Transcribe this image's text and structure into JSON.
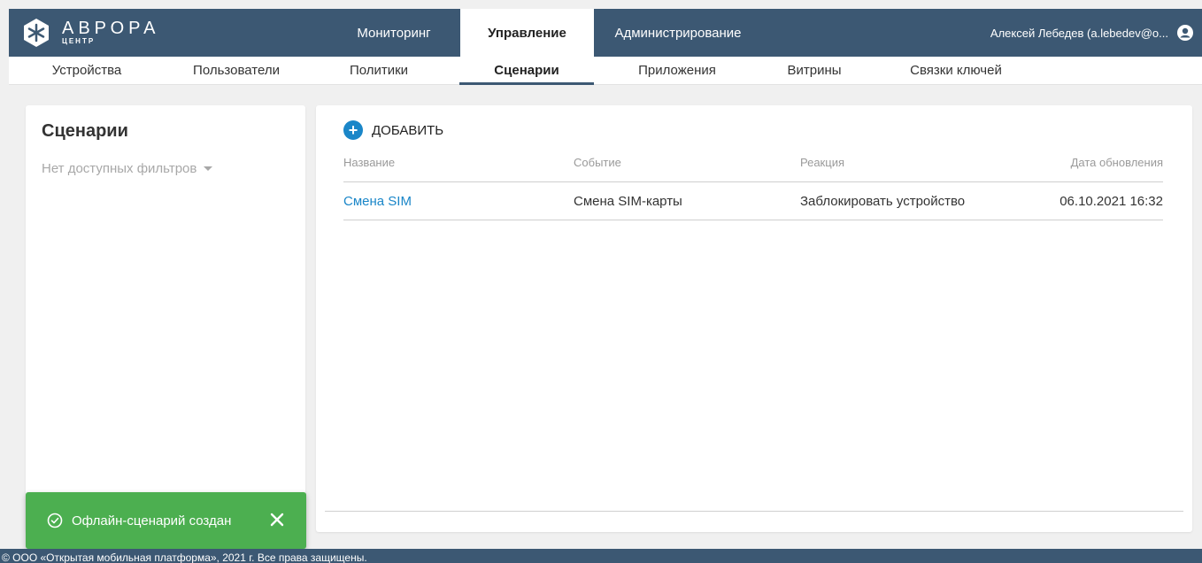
{
  "brand": {
    "name": "АВРОРА",
    "sub": "ЦЕНТР"
  },
  "nav": {
    "tabs": [
      {
        "label": "Мониторинг"
      },
      {
        "label": "Управление"
      },
      {
        "label": "Администрирование"
      }
    ],
    "active_tab": "Управление",
    "user": "Алексей Лебедев (a.lebedev@o..."
  },
  "subnav": {
    "items": [
      {
        "label": "Устройства"
      },
      {
        "label": "Пользователи"
      },
      {
        "label": "Политики"
      },
      {
        "label": "Сценарии"
      },
      {
        "label": "Приложения"
      },
      {
        "label": "Витрины"
      },
      {
        "label": "Связки ключей"
      }
    ],
    "active_item": "Сценарии"
  },
  "sidebar": {
    "title": "Сценарии",
    "filter_label": "Нет доступных фильтров"
  },
  "main": {
    "add_label": "ДОБАВИТЬ",
    "columns": [
      "Название",
      "Событие",
      "Реакция",
      "Дата обновления"
    ],
    "rows": [
      {
        "name": "Смена SIM",
        "event": "Смена SIM-карты",
        "reaction": "Заблокировать устройство",
        "updated": "06.10.2021 16:32"
      }
    ]
  },
  "toast": {
    "message": "Офлайн-сценарий создан"
  },
  "footer": {
    "text": "© ООО «Открытая мобильная платформа», 2021 г. Все права защищены."
  },
  "colors": {
    "header_bg": "#3c5873",
    "accent_blue": "#1a86c8",
    "toast_green": "#4caf50",
    "page_bg": "#f0f0f0"
  },
  "icons": [
    "aurora-logo-icon",
    "user-circle-icon",
    "chevron-down-icon",
    "plus-circle-icon",
    "check-circle-icon",
    "close-icon"
  ]
}
